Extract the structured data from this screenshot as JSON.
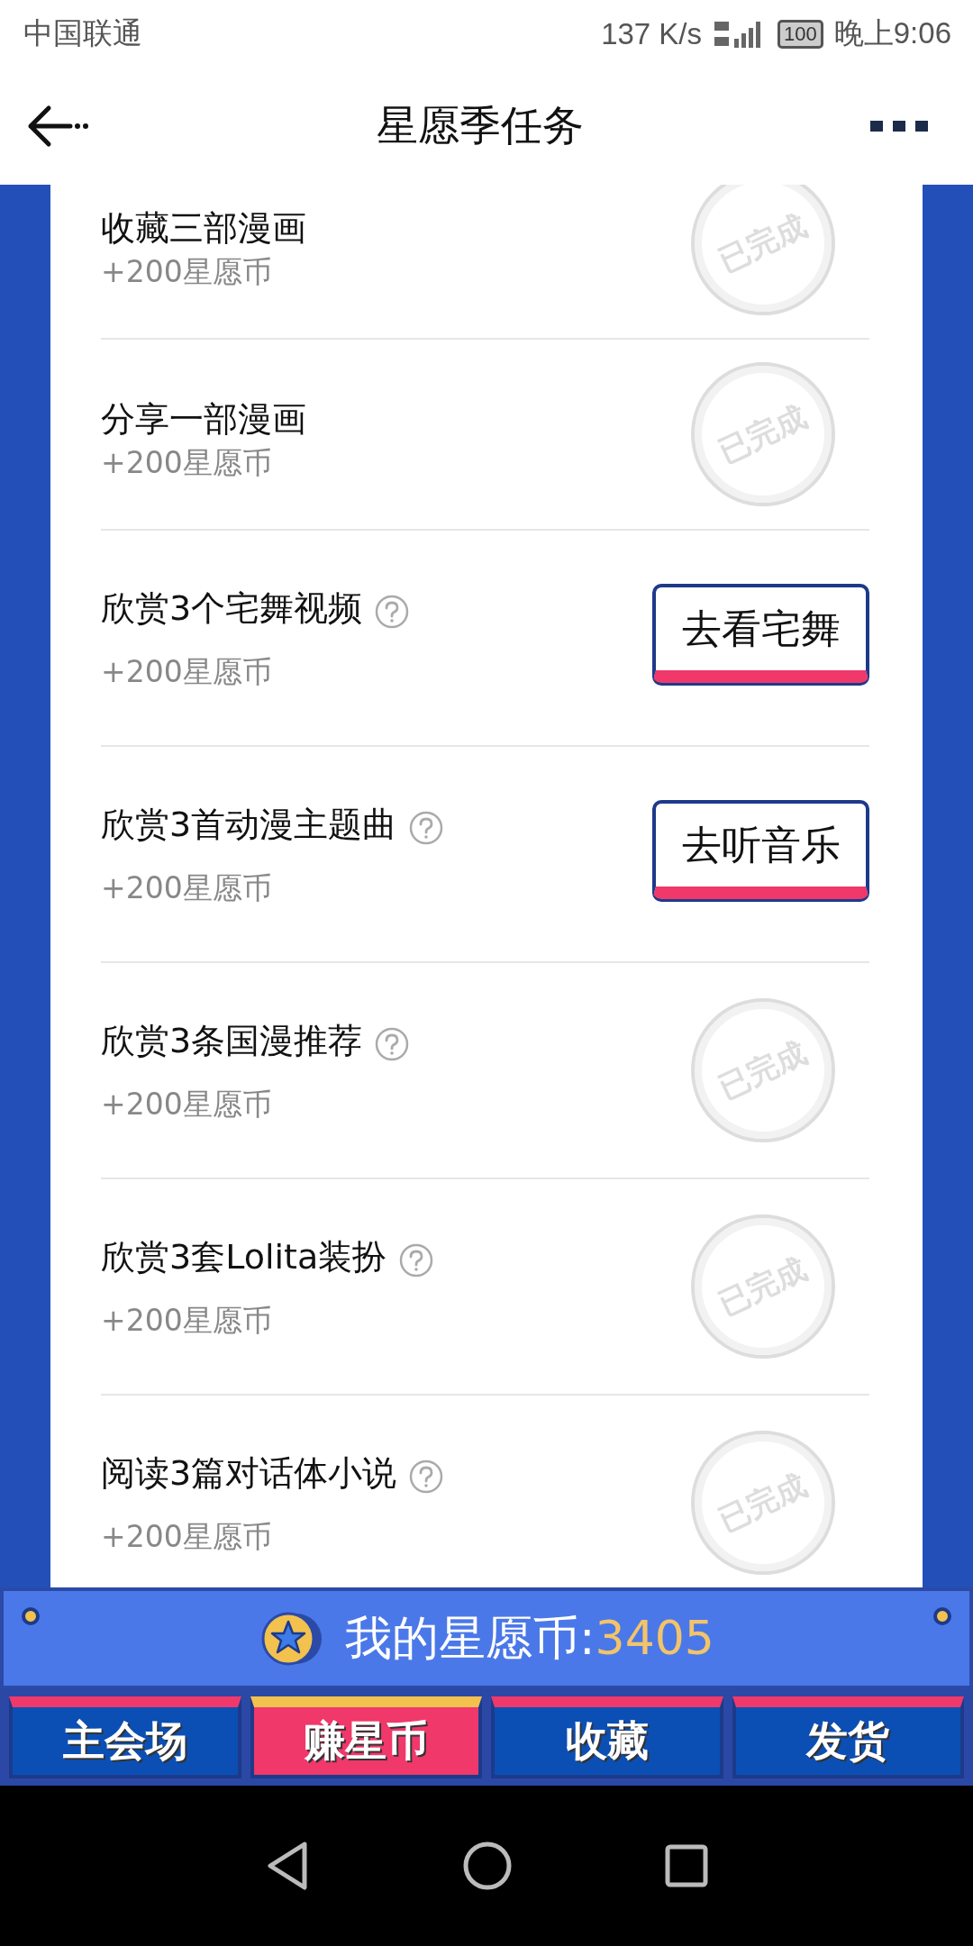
{
  "status_bar": {
    "carrier": "中国联通",
    "speed": "137 K/s",
    "battery": "100",
    "time": "晚上9:06"
  },
  "header": {
    "title": "星愿季任务"
  },
  "tasks": [
    {
      "title": "收藏三部漫画",
      "reward": "+200星愿币",
      "help": false,
      "action": {
        "kind": "done",
        "label": "已完成"
      }
    },
    {
      "title": "分享一部漫画",
      "reward": "+200星愿币",
      "help": false,
      "action": {
        "kind": "done",
        "label": "已完成"
      }
    },
    {
      "title": "欣赏3个宅舞视频",
      "reward": "+200星愿币",
      "help": true,
      "action": {
        "kind": "button",
        "label": "去看宅舞"
      }
    },
    {
      "title": "欣赏3首动漫主题曲",
      "reward": "+200星愿币",
      "help": true,
      "action": {
        "kind": "button",
        "label": "去听音乐"
      }
    },
    {
      "title": "欣赏3条国漫推荐",
      "reward": "+200星愿币",
      "help": true,
      "action": {
        "kind": "done",
        "label": "已完成"
      }
    },
    {
      "title": "欣赏3套Lolita装扮",
      "reward": "+200星愿币",
      "help": true,
      "action": {
        "kind": "done",
        "label": "已完成"
      }
    },
    {
      "title": "阅读3篇对话体小说",
      "reward": "+200星愿币",
      "help": true,
      "action": {
        "kind": "done",
        "label": "已完成"
      }
    }
  ],
  "coins": {
    "label": "我的星愿币:",
    "value": "3405"
  },
  "tabs": [
    {
      "label": "主会场",
      "selected": false
    },
    {
      "label": "赚星币",
      "selected": true
    },
    {
      "label": "收藏",
      "selected": false
    },
    {
      "label": "发货",
      "selected": false
    }
  ]
}
